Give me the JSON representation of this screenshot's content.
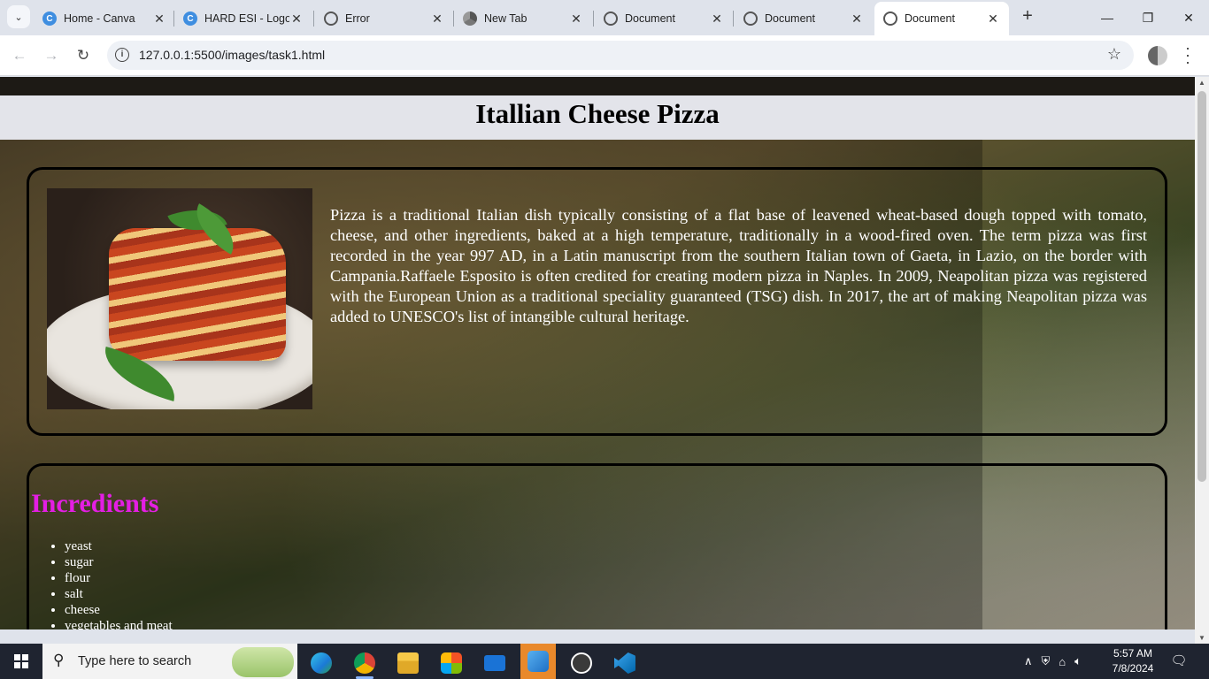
{
  "browser": {
    "tab_search_icon": "chevron-down-icon",
    "tabs": [
      {
        "title": "Home - Canva",
        "favicon": "canva-icon"
      },
      {
        "title": "HARD ESI - Logo",
        "favicon": "canva-icon"
      },
      {
        "title": "Error",
        "favicon": "globe-icon"
      },
      {
        "title": "New Tab",
        "favicon": "chrome-icon"
      },
      {
        "title": "Document",
        "favicon": "globe-icon"
      },
      {
        "title": "Document",
        "favicon": "globe-icon"
      },
      {
        "title": "Document",
        "favicon": "globe-icon",
        "active": true
      }
    ],
    "new_tab_label": "+",
    "window_controls": {
      "minimize": "—",
      "restore": "❐",
      "close": "✕"
    },
    "url": "127.0.0.1:5500/images/task1.html"
  },
  "page": {
    "title": "Itallian Cheese Pizza",
    "about": "Pizza is a traditional Italian dish typically consisting of a flat base of leavened wheat-based dough topped with tomato, cheese, and other ingredients, baked at a high temperature, traditionally in a wood-fired oven. The term pizza was first recorded in the year 997 AD, in a Latin manuscript from the southern Italian town of Gaeta, in Lazio, on the border with Campania.Raffaele Esposito is often credited for creating modern pizza in Naples. In 2009, Neapolitan pizza was registered with the European Union as a traditional speciality guaranteed (TSG) dish. In 2017, the art of making Neapolitan pizza was added to UNESCO's list of intangible cultural heritage.",
    "ingredients_title": "Incredients",
    "ingredients": [
      "yeast",
      "sugar",
      "flour",
      "salt",
      "cheese",
      "vegetables and meat"
    ],
    "colors": {
      "ingredients_title": "#e41ee4",
      "header_bg": "#e3e4ea"
    }
  },
  "taskbar": {
    "search_placeholder": "Type here to search",
    "apps": [
      "edge-icon",
      "chrome-icon",
      "file-explorer-icon",
      "store-icon",
      "mail-icon",
      "paint-icon",
      "media-player-icon",
      "vscode-icon"
    ],
    "time": "5:57 AM",
    "date": "7/8/2024"
  }
}
